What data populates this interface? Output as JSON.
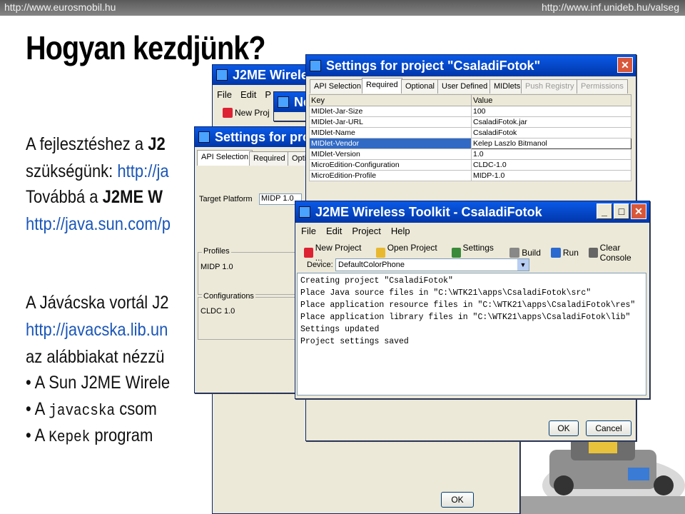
{
  "header": {
    "left_url": "http://www.eurosmobil.hu",
    "right_url": "http://www.inf.unideb.hu/valseg"
  },
  "slide": {
    "title": "Hogyan kezdjünk?",
    "line1_pre": "A fejlesztéshez a ",
    "line1_bold": "J2",
    "line2_pre": "szükségünk: ",
    "line2_link": "http://ja",
    "line3_pre": "Továbbá a ",
    "line3_bold": "J2ME W",
    "line4_link": "http://java.sun.com/p",
    "line5": "A Jávácska vortál J2",
    "line6_link": "http://javacska.lib.un",
    "line7": "az alábbiakat nézzü",
    "bullet1": "A Sun J2ME Wirele",
    "bullet2_pre": "A ",
    "bullet2_mono": "javacska",
    "bullet2_post": " csom",
    "bullet3_pre": "A ",
    "bullet3_mono": "Kepek",
    "bullet3_post": " program",
    "bullet_char": "•"
  },
  "win_back": {
    "title": "J2ME Wirele",
    "menu": [
      "File",
      "Edit",
      "P"
    ],
    "tool_new": "New Proj",
    "ok": "OK"
  },
  "win_newproj": {
    "title": "New"
  },
  "win_settings_left": {
    "title": "Settings for pro",
    "tabs": [
      "API Selection",
      "Required",
      "Opti"
    ],
    "target_platform_label": "Target Platform",
    "target_platform_value": "MIDP 1.0",
    "profiles_label": "Profiles",
    "profiles_value": "MIDP 1.0",
    "configurations_label": "Configurations",
    "configurations_value": "CLDC 1.0"
  },
  "win_settings": {
    "title": "Settings for project \"CsaladiFotok\"",
    "close": "✕",
    "tabs": [
      "API Selection",
      "Required",
      "Optional",
      "User Defined",
      "MIDlets",
      "Push Registry",
      "Permissions"
    ],
    "table_header": [
      "Key",
      "Value"
    ],
    "rows": [
      {
        "key": "MIDlet-Jar-Size",
        "value": "100"
      },
      {
        "key": "MIDlet-Jar-URL",
        "value": "CsaladiFotok.jar"
      },
      {
        "key": "MIDlet-Name",
        "value": "CsaladiFotok"
      },
      {
        "key": "MIDlet-Vendor",
        "value": "Kelep Laszlo Bitmanol"
      },
      {
        "key": "MIDlet-Version",
        "value": "1.0"
      },
      {
        "key": "MicroEdition-Configuration",
        "value": "CLDC-1.0"
      },
      {
        "key": "MicroEdition-Profile",
        "value": "MIDP-1.0"
      }
    ],
    "ok": "OK",
    "cancel": "Cancel"
  },
  "win_toolkit": {
    "title": "J2ME Wireless Toolkit - CsaladiFotok",
    "btn_min": "_",
    "btn_max": "□",
    "btn_close": "✕",
    "menu": [
      "File",
      "Edit",
      "Project",
      "Help"
    ],
    "tools": [
      "New Project ...",
      "Open Project ...",
      "Settings ...",
      "Build",
      "Run",
      "Clear Console"
    ],
    "device_label": "Device:",
    "device_value": "DefaultColorPhone",
    "console_lines": [
      "Creating project \"CsaladiFotok\"",
      "Place Java source files in \"C:\\WTK21\\apps\\CsaladiFotok\\src\"",
      "Place application resource files in \"C:\\WTK21\\apps\\CsaladiFotok\\res\"",
      "Place application library files in \"C:\\WTK21\\apps\\CsaladiFotok\\lib\"",
      "Settings updated",
      "Project settings saved"
    ]
  },
  "colors": {
    "xp_title": "#0a5ae8",
    "link": "#1a56b8",
    "selected_row": "#316ac5"
  }
}
